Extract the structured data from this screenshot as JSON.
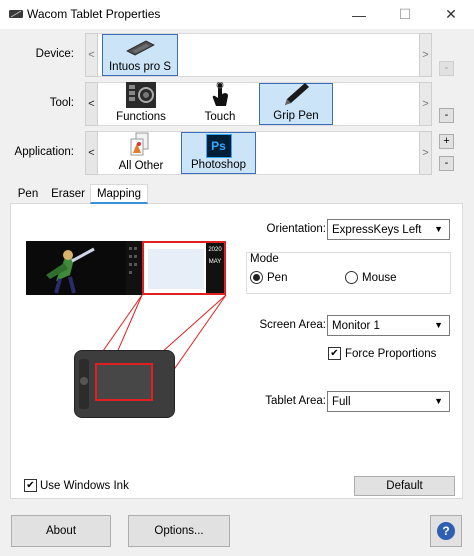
{
  "window": {
    "title": "Wacom Tablet Properties",
    "minimize": "—",
    "maximize": "☐",
    "close": "✕"
  },
  "rows": {
    "device": {
      "label": "Device:",
      "items": [
        {
          "label": "Intuos pro S",
          "selected": true
        }
      ]
    },
    "tool": {
      "label": "Tool:",
      "items": [
        {
          "label": "Functions"
        },
        {
          "label": "Touch"
        },
        {
          "label": "Grip Pen",
          "selected": true
        }
      ]
    },
    "application": {
      "label": "Application:",
      "items": [
        {
          "label": "All Other"
        },
        {
          "label": "Photoshop",
          "selected": true,
          "icon_text": "Ps"
        }
      ]
    }
  },
  "controls": {
    "left_arrow": "<",
    "right_arrow": ">",
    "add": "+",
    "remove": "-"
  },
  "tabs": [
    {
      "label": "Pen"
    },
    {
      "label": "Eraser"
    },
    {
      "label": "Mapping",
      "active": true
    }
  ],
  "mapping": {
    "orientation": {
      "label": "Orientation:",
      "value": "ExpressKeys Left"
    },
    "mode": {
      "title": "Mode",
      "options": [
        {
          "label": "Pen",
          "checked": true
        },
        {
          "label": "Mouse",
          "checked": false
        }
      ]
    },
    "screen_area": {
      "label": "Screen Area:",
      "value": "Monitor 1"
    },
    "force_proportions": {
      "label": "Force Proportions",
      "checked": true
    },
    "tablet_area": {
      "label": "Tablet Area:",
      "value": "Full"
    },
    "use_windows_ink": {
      "label": "Use Windows Ink",
      "checked": true
    },
    "default_button": "Default",
    "preview_text": {
      "date": "2020",
      "month": "MAY"
    }
  },
  "footer": {
    "about": "About",
    "options": "Options...",
    "help": "?"
  },
  "colors": {
    "selected_bg": "#cce4f7",
    "selected_border": "#3b6eb8",
    "mapping_red": "#e02020",
    "tab_underline": "#3b8fd9",
    "ps_blue": "#31a8ff",
    "ps_dark": "#001e36"
  }
}
